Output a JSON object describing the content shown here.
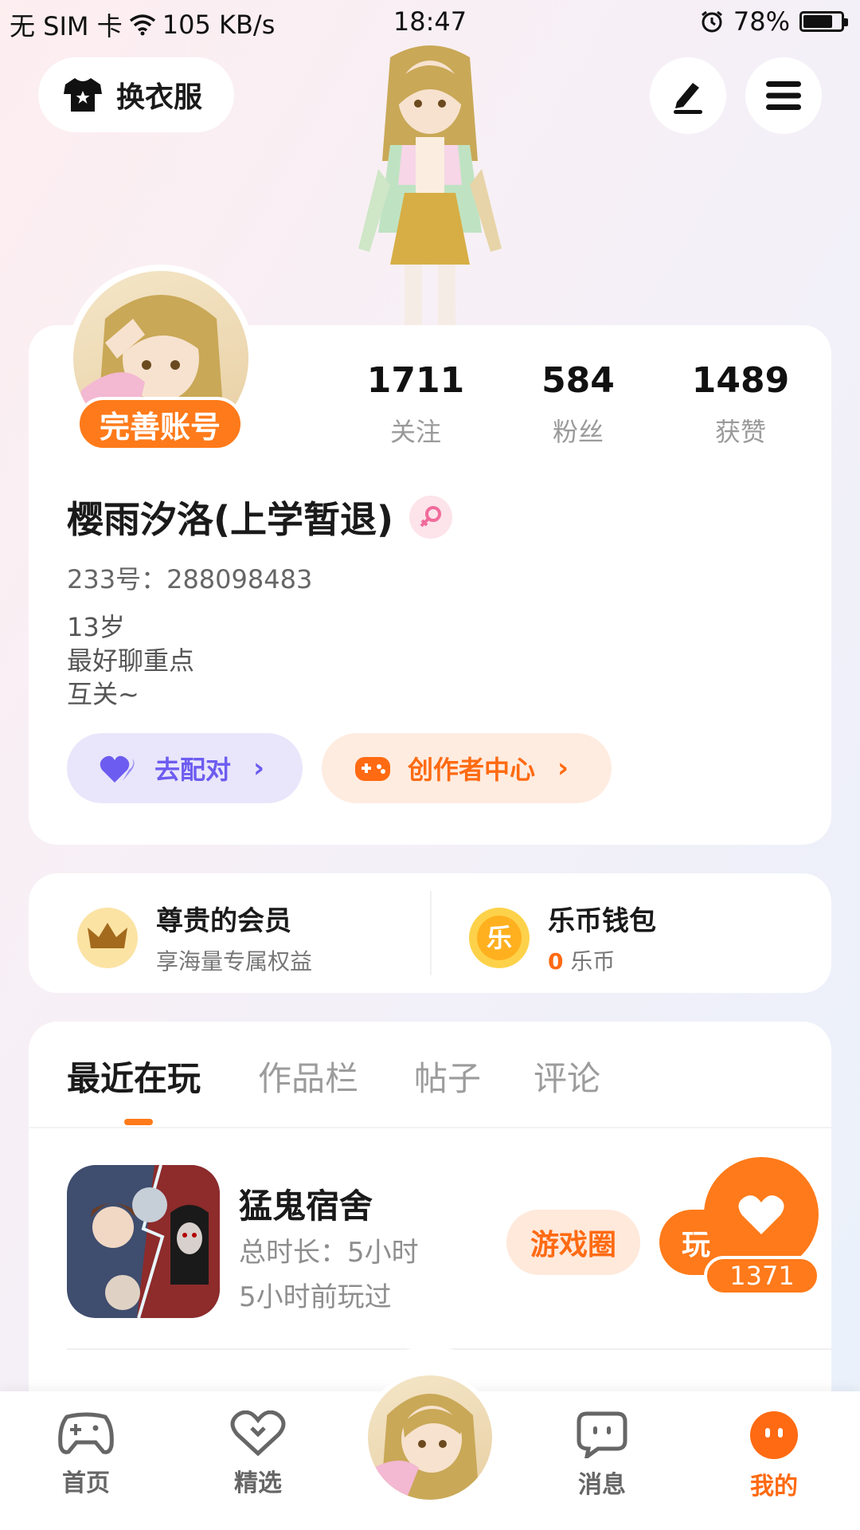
{
  "status_bar": {
    "carrier": "无 SIM 卡",
    "speed": "105 KB/s",
    "time": "18:47",
    "battery": "78%",
    "battery_level": 0.78
  },
  "top_bar": {
    "outfit_label": "换衣服",
    "edit_icon": "pen-icon",
    "menu_icon": "hamburger-menu-icon"
  },
  "profile": {
    "complete_account_label": "完善账号",
    "stats": [
      {
        "value": "1711",
        "label": "关注"
      },
      {
        "value": "584",
        "label": "粉丝"
      },
      {
        "value": "1489",
        "label": "获赞"
      }
    ],
    "username": "樱雨汐洛(上学暂退)",
    "gender_icon": "female-icon",
    "uid": "233号：288098483",
    "bio_lines": [
      "13岁",
      "最好聊重点",
      "互关~"
    ],
    "match_label": "去配对",
    "creator_label": "创作者中心"
  },
  "vip": {
    "member_title": "尊贵的会员",
    "member_sub": "享海量专属权益",
    "wallet_title": "乐币钱包",
    "wallet_count": "0",
    "wallet_unit": "乐币",
    "coin_glyph": "乐"
  },
  "tabs": [
    "最近在玩",
    "作品栏",
    "帖子",
    "评论"
  ],
  "games": [
    {
      "name": "猛鬼宿舍",
      "duration": "总时长：5小时",
      "last_played": "5小时前玩过",
      "circle_label": "游戏圈",
      "play_label": "玩"
    }
  ],
  "like_fab": {
    "count": "1371"
  },
  "bottom_nav": {
    "items": [
      "首页",
      "精选",
      "消息",
      "我的"
    ]
  },
  "colors": {
    "accent": "#ff7a1a",
    "match_purple": "#6d5cf0"
  }
}
